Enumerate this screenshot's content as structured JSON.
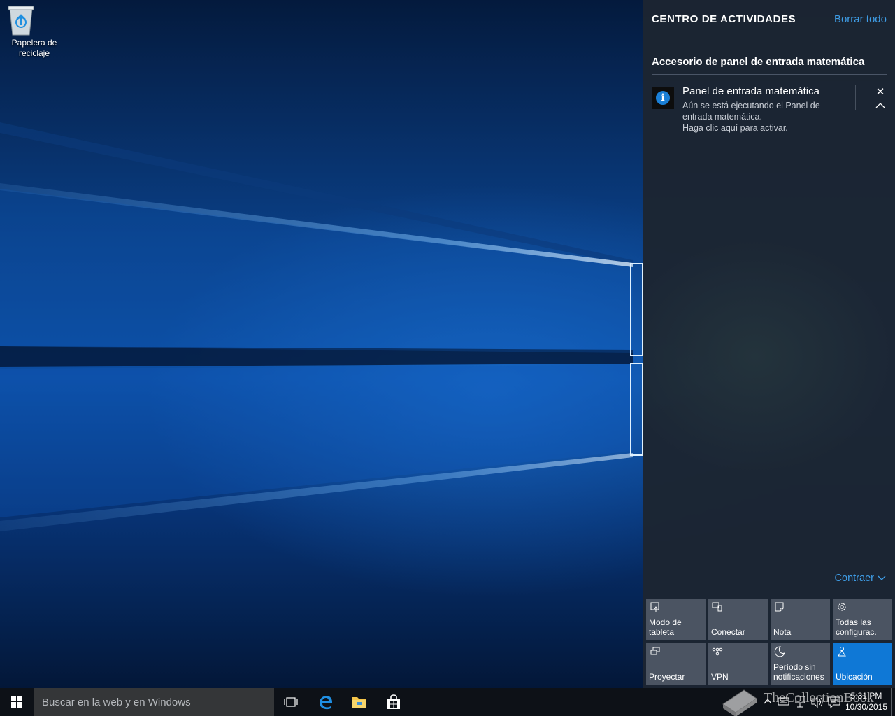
{
  "desktop": {
    "recycle_bin_label_line1": "Papelera de",
    "recycle_bin_label_line2": "reciclaje"
  },
  "action_center": {
    "title": "CENTRO DE ACTIVIDADES",
    "clear_all": "Borrar todo",
    "group_title": "Accesorio de panel de entrada matemática",
    "notification": {
      "icon": "info-icon",
      "icon_glyph": "i",
      "title": "Panel de entrada matemática",
      "body_lines": [
        "Aún se está ejecutando el Panel de",
        "entrada matemática.",
        "Haga clic aquí para activar."
      ],
      "close_glyph": "✕"
    },
    "collapse": "Contraer",
    "accent_color": "#0f78d6",
    "quick_actions": [
      {
        "label_line1": "Modo de",
        "label_line2": "tableta",
        "icon": "tablet-mode-icon",
        "active": false
      },
      {
        "label_line1": "",
        "label_line2": "Conectar",
        "icon": "connect-icon",
        "active": false
      },
      {
        "label_line1": "",
        "label_line2": "Nota",
        "icon": "note-icon",
        "active": false
      },
      {
        "label_line1": "Todas las",
        "label_line2": "configurac.",
        "icon": "settings-gear-icon",
        "active": false
      },
      {
        "label_line1": "",
        "label_line2": "Proyectar",
        "icon": "project-icon",
        "active": false
      },
      {
        "label_line1": "",
        "label_line2": "VPN",
        "icon": "vpn-icon",
        "active": false
      },
      {
        "label_line1": "Período sin",
        "label_line2": "notificaciones",
        "icon": "quiet-hours-moon-icon",
        "active": false
      },
      {
        "label_line1": "",
        "label_line2": "Ubicación",
        "icon": "location-icon",
        "active": true
      }
    ]
  },
  "taskbar": {
    "search_placeholder": "Buscar en la web y en Windows",
    "clock_time": "5:31 PM",
    "clock_date": "10/30/2015",
    "watermark": "TheCollectionBook"
  }
}
